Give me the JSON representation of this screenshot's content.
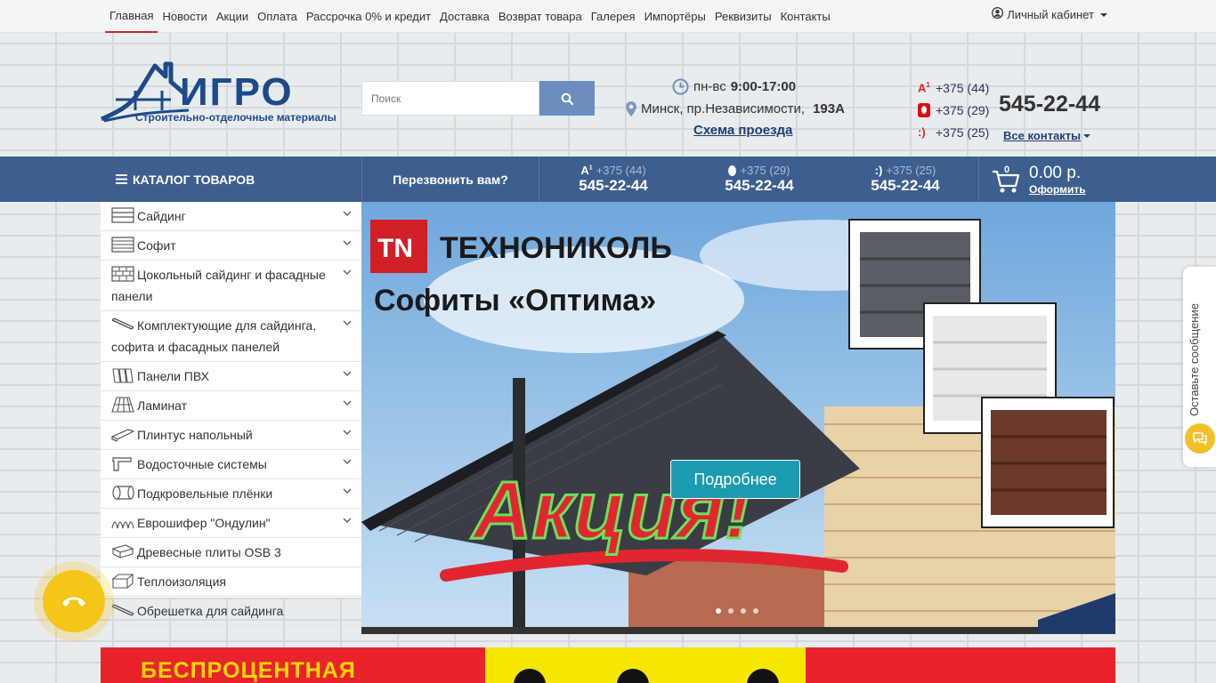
{
  "top_nav": [
    {
      "label": "Главная",
      "active": true
    },
    {
      "label": "Новости"
    },
    {
      "label": "Акции"
    },
    {
      "label": "Оплата"
    },
    {
      "label": "Рассрочка 0% и кредит"
    },
    {
      "label": "Доставка"
    },
    {
      "label": "Возврат товара"
    },
    {
      "label": "Галерея"
    },
    {
      "label": "Импортёры"
    },
    {
      "label": "Реквизиты"
    },
    {
      "label": "Контакты"
    }
  ],
  "account": {
    "label": "Личный кабинет",
    "icon": "user-icon"
  },
  "logo": {
    "text": "ИГРО",
    "subtitle": "Строительно-отделочные материалы"
  },
  "search": {
    "placeholder": "Поиск",
    "icon": "search-icon"
  },
  "info": {
    "hours_label": "пн-вс",
    "hours_value": "9:00-17:00",
    "address": "Минск, пр.Независимости,",
    "address_num": "193А",
    "map_link": "Схема проезда"
  },
  "phones_top": [
    {
      "operator": "A1",
      "code": "+375 (44)"
    },
    {
      "operator": "MTS",
      "code": "+375 (29)"
    },
    {
      "operator": "life",
      "code": "+375 (25)"
    }
  ],
  "main_phone": "545-22-44",
  "all_contacts": "Все контакты",
  "navbar": {
    "catalog": "КАТАЛОГ ТОВАРОВ",
    "callback": "Перезвонить вам?",
    "phones": [
      {
        "operator": "A1",
        "code": "+375 (44)",
        "number": "545-22-44"
      },
      {
        "operator": "MTS",
        "code": "+375 (29)",
        "number": "545-22-44"
      },
      {
        "operator": "life",
        "code": "+375 (25)",
        "number": "545-22-44"
      }
    ],
    "cart": {
      "count": "0",
      "total": "0.00 р.",
      "checkout": "Оформить"
    }
  },
  "categories": [
    {
      "label": "Сайдинг",
      "icon": "siding-icon",
      "expandable": true
    },
    {
      "label": "Софит",
      "icon": "soffit-icon",
      "expandable": true
    },
    {
      "label": "Цокольный сайдинг и фасадные панели",
      "icon": "brick-icon",
      "expandable": true
    },
    {
      "label": "Комплектующие для сайдинга, софита и фасадных панелей",
      "icon": "profile-icon",
      "expandable": true
    },
    {
      "label": "Панели ПВХ",
      "icon": "pvc-panel-icon",
      "expandable": true
    },
    {
      "label": "Ламинат",
      "icon": "laminate-icon",
      "expandable": true
    },
    {
      "label": "Плинтус напольный",
      "icon": "baseboard-icon",
      "expandable": true
    },
    {
      "label": "Водосточные системы",
      "icon": "gutter-icon",
      "expandable": true
    },
    {
      "label": "Подкровельные плёнки",
      "icon": "membrane-roll-icon",
      "expandable": true
    },
    {
      "label": "Еврошифер \"Ондулин\"",
      "icon": "ondulin-icon",
      "expandable": true
    },
    {
      "label": "Древесные плиты OSB 3",
      "icon": "osb-icon",
      "expandable": false
    },
    {
      "label": "Теплоизоляция",
      "icon": "insulation-icon",
      "expandable": false
    },
    {
      "label": "Обрешетка для сайдинга",
      "icon": "lath-icon",
      "expandable": false
    }
  ],
  "banner": {
    "brand": "ТЕХНОНИКОЛЬ",
    "headline": "Софиты «Оптима»",
    "promo": "Акция!",
    "button": "Подробнее",
    "slides": 4,
    "active_slide": 1
  },
  "promo_strip": {
    "text": "БЕСПРОЦЕНТНАЯ"
  },
  "feedback": {
    "label": "Оставьте сообщение",
    "icon": "chat-icon"
  },
  "call_button": {
    "icon": "phone-icon"
  },
  "colors": {
    "navbar": "#3d5f8f",
    "accent_red": "#c8282c",
    "button_teal": "#1a9bb0",
    "call_yellow": "#f5c518",
    "search_button": "#6c8ebf"
  }
}
